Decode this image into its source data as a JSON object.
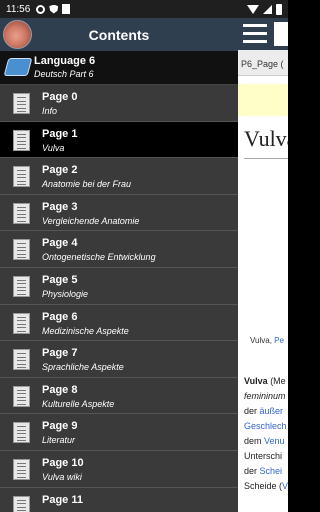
{
  "status_bar": {
    "time": "11:56"
  },
  "drawer": {
    "title": "Contents",
    "language_item": {
      "title": "Language 6",
      "subtitle": "Deutsch Part 6"
    },
    "pages": [
      {
        "title": "Page 0",
        "subtitle": "Info"
      },
      {
        "title": "Page 1",
        "subtitle": "Vulva",
        "selected": true
      },
      {
        "title": "Page 2",
        "subtitle": "Anatomie bei der Frau"
      },
      {
        "title": "Page 3",
        "subtitle": "Vergleichende Anatomie"
      },
      {
        "title": "Page 4",
        "subtitle": "Ontogenetische Entwicklung"
      },
      {
        "title": "Page 5",
        "subtitle": "Physiologie"
      },
      {
        "title": "Page 6",
        "subtitle": "Medizinische Aspekte"
      },
      {
        "title": "Page 7",
        "subtitle": "Sprachliche Aspekte"
      },
      {
        "title": "Page 8",
        "subtitle": "Kulturelle Aspekte"
      },
      {
        "title": "Page 9",
        "subtitle": "Literatur"
      },
      {
        "title": "Page 10",
        "subtitle": "Vulva wiki"
      },
      {
        "title": "Page 11",
        "subtitle": ""
      }
    ]
  },
  "content": {
    "tab_label": "P6_Page (",
    "heading": "Vulva",
    "caption_text": "Vulva, ",
    "caption_link": "Pe",
    "article_lines": [
      {
        "parts": [
          {
            "text": "Vulva",
            "style": "bold"
          },
          {
            "text": " (Me",
            "style": "normal"
          }
        ]
      },
      {
        "parts": [
          {
            "text": "femininum",
            "style": "italic"
          }
        ]
      },
      {
        "parts": [
          {
            "text": "der ",
            "style": "normal"
          },
          {
            "text": "äußer",
            "style": "link"
          }
        ]
      },
      {
        "parts": [
          {
            "text": "Geschlech",
            "style": "link"
          }
        ]
      },
      {
        "parts": [
          {
            "text": "dem ",
            "style": "normal"
          },
          {
            "text": "Venu",
            "style": "link"
          }
        ]
      },
      {
        "parts": [
          {
            "text": "Unterschi",
            "style": "normal"
          }
        ]
      },
      {
        "parts": [
          {
            "text": "der ",
            "style": "normal"
          },
          {
            "text": "Schei",
            "style": "link"
          }
        ]
      },
      {
        "parts": [
          {
            "text": "Scheide (",
            "style": "normal"
          },
          {
            "text": "V",
            "style": "link"
          }
        ]
      }
    ]
  },
  "colors": {
    "appbar": "#2f3f4f",
    "drawer_bg": "#3a3a3a",
    "selected_bg": "#000000",
    "link": "#3366cc"
  }
}
